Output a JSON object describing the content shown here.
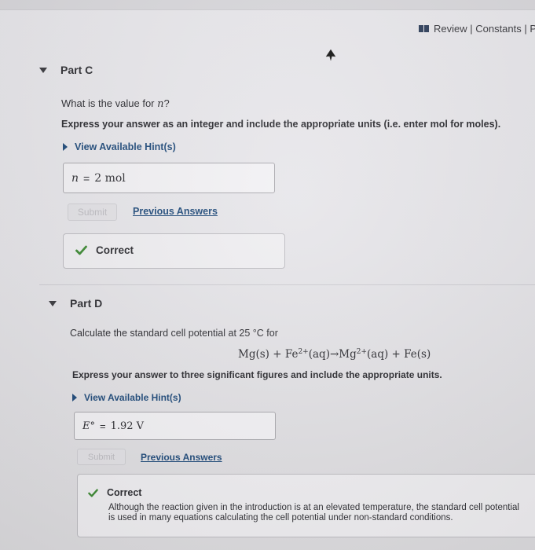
{
  "header": {
    "review_label": "Review | Constants | P"
  },
  "partC": {
    "title": "Part C",
    "question_prefix": "What is the value for ",
    "question_var": "n",
    "question_suffix": "?",
    "instruction": "Express your answer as an integer and include the appropriate units (i.e. enter mol for moles).",
    "hint_label": "View Available Hint(s)",
    "answer": {
      "var": "n",
      "eq": "=",
      "value": "2 mol"
    },
    "submit_label": "Submit",
    "previous_answers_label": "Previous Answers",
    "result_label": "Correct"
  },
  "partD": {
    "title": "Part D",
    "question": "Calculate the standard cell potential at 25 °C for",
    "equation": {
      "lhs": "Mg(s) + Fe",
      "lhs_charge": "2+",
      "mid": "(aq)→Mg",
      "mid_charge": "2+",
      "rhs": "(aq) + Fe(s)"
    },
    "instruction": "Express your answer to three significant figures and include the appropriate units.",
    "hint_label": "View Available Hint(s)",
    "answer": {
      "var": "E°",
      "eq": "=",
      "value": "1.92 V"
    },
    "submit_label": "Submit",
    "previous_answers_label": "Previous Answers",
    "result_label": "Correct",
    "explanation_line1": "Although the reaction given in the introduction is at an elevated temperature, the standard cell potential",
    "explanation_line2": "is used in many equations calculating the cell potential under non-standard conditions."
  },
  "colors": {
    "link": "#1f4a7a",
    "check": "#3d8a34",
    "background": "#e8e7eb"
  }
}
